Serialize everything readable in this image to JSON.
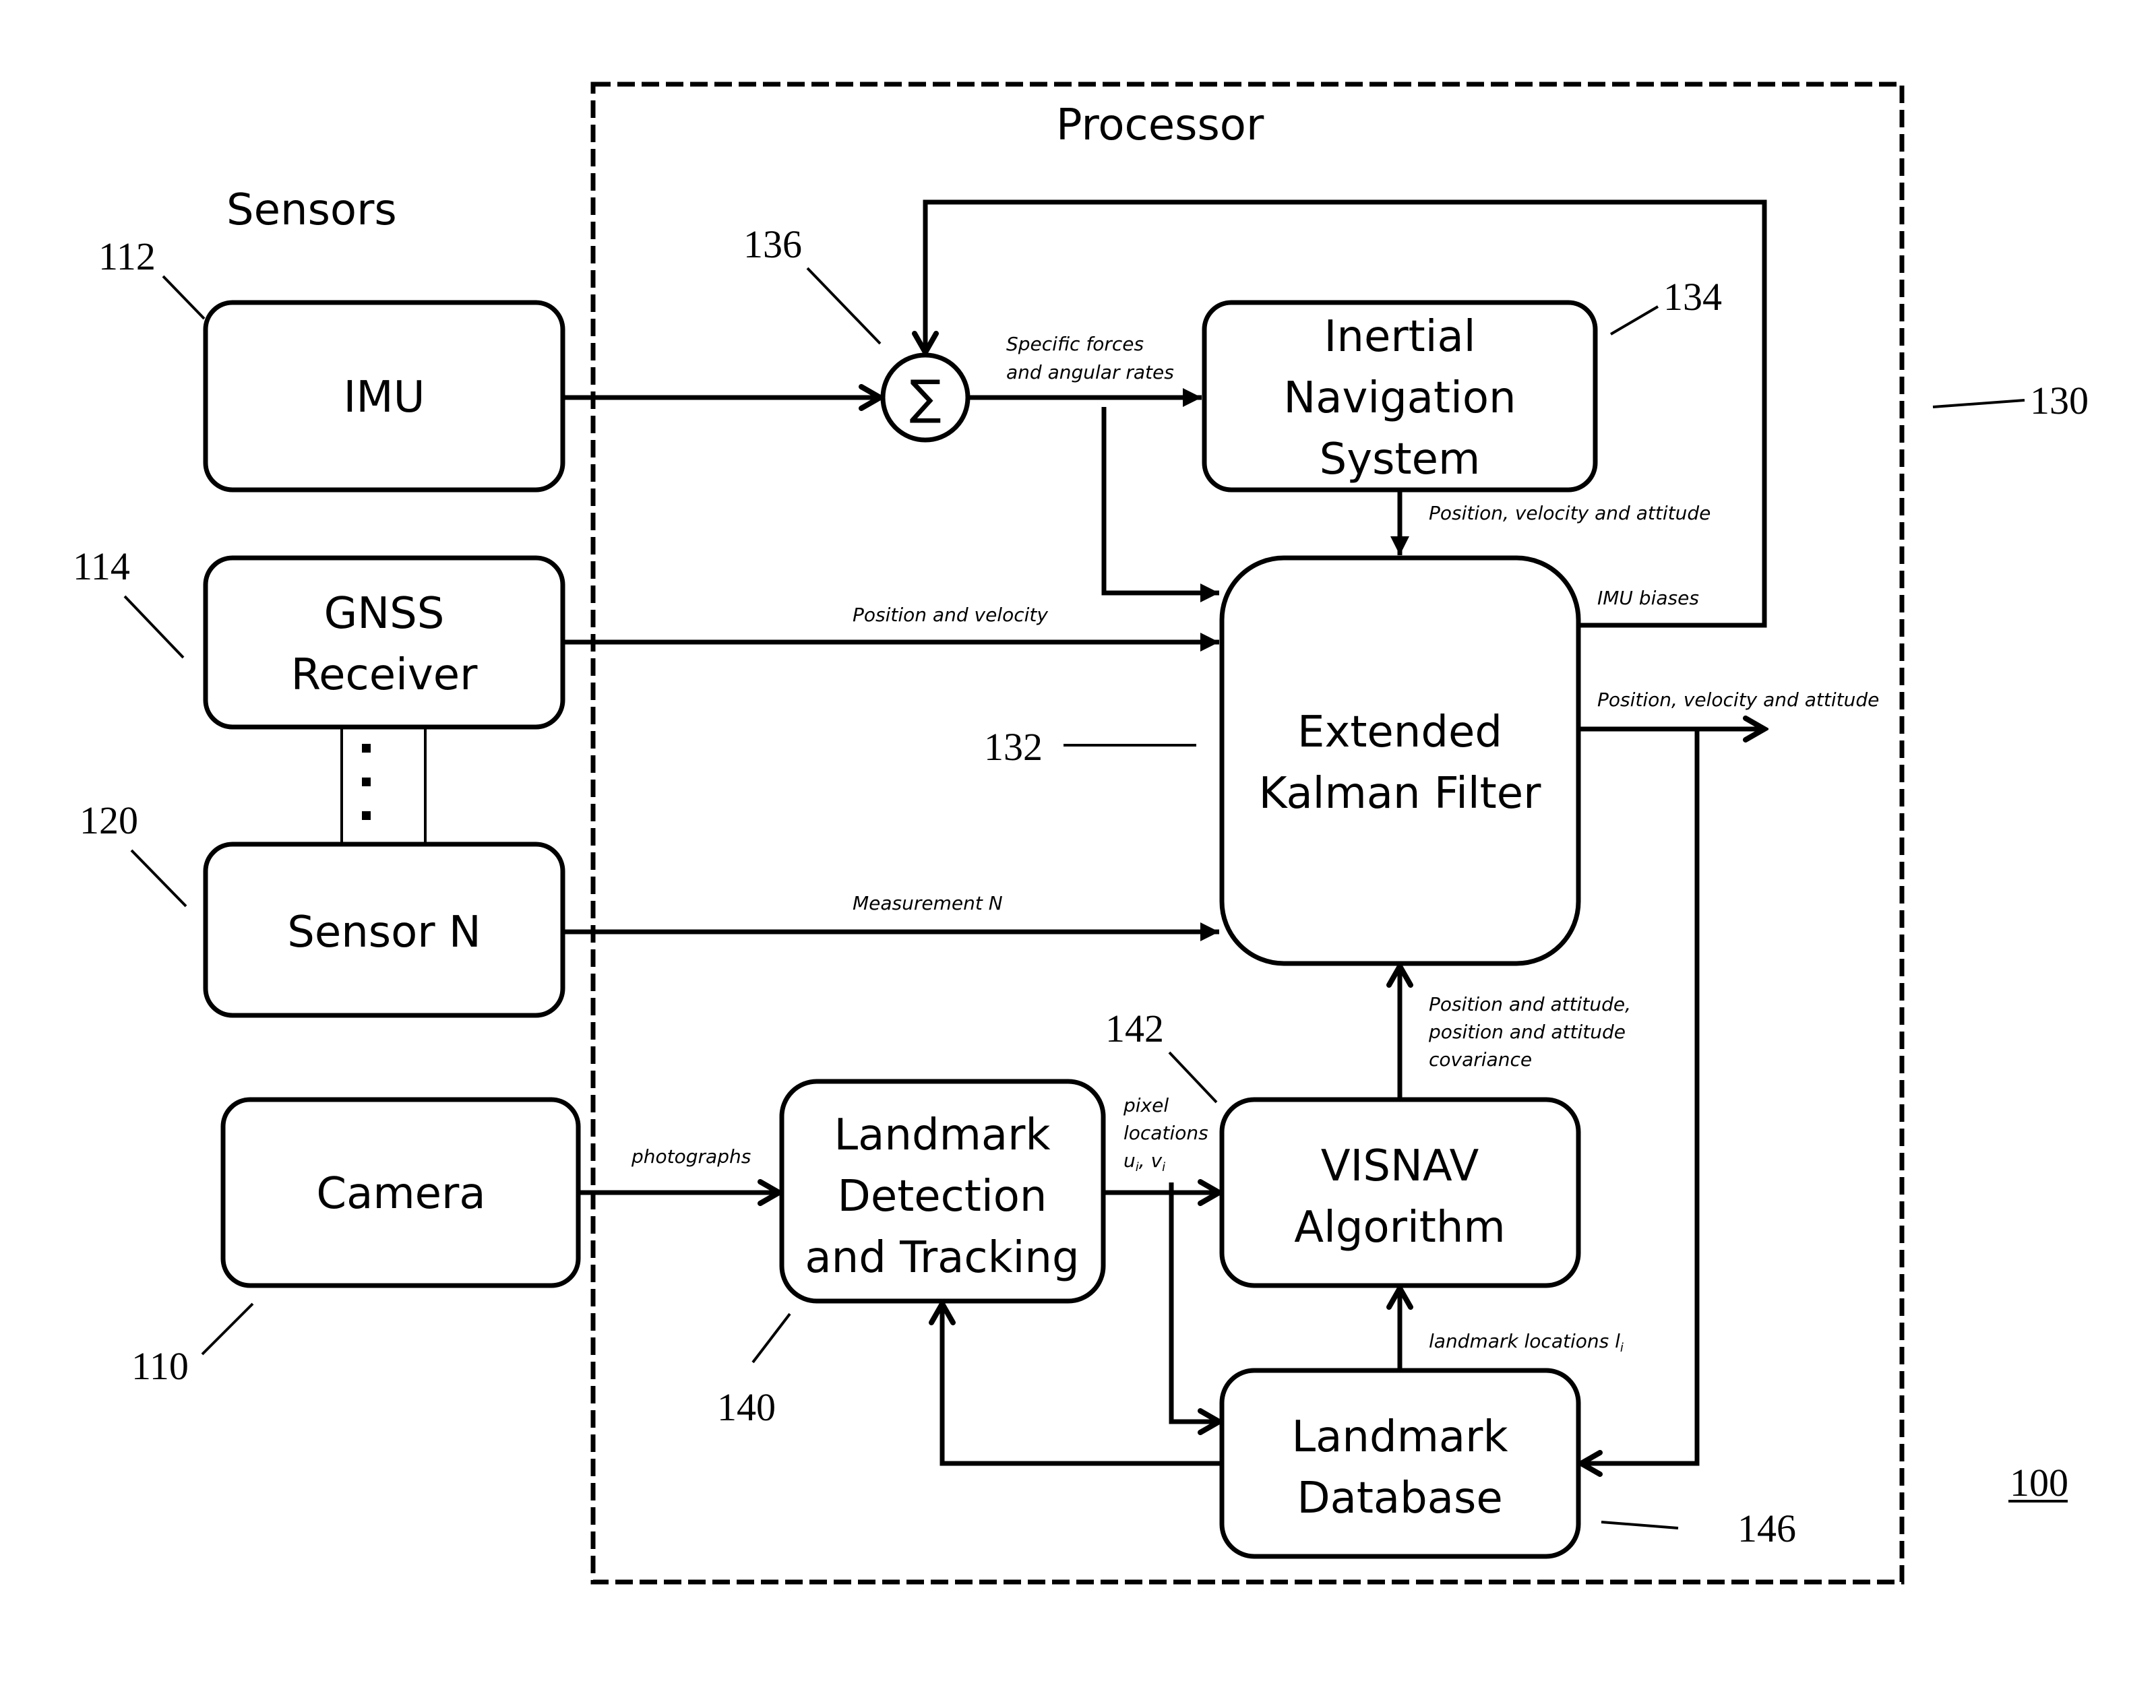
{
  "figure": {
    "ref_label": "100",
    "sections": {
      "sensors_title": "Sensors",
      "processor_title": "Processor"
    },
    "sensors": [
      {
        "id": "imu",
        "lines": [
          "IMU"
        ],
        "ref": "112"
      },
      {
        "id": "gnss",
        "lines": [
          "GNSS",
          "Receiver"
        ],
        "ref": "114"
      },
      {
        "id": "sensor_n",
        "lines": [
          "Sensor N"
        ],
        "ref": "120"
      },
      {
        "id": "camera",
        "lines": [
          "Camera"
        ],
        "ref": "110"
      }
    ],
    "processor": {
      "ref": "130",
      "summer": {
        "symbol": "∑",
        "ref": "136"
      },
      "ins": {
        "lines": [
          "Inertial",
          "Navigation",
          "System"
        ],
        "ref": "134"
      },
      "ekf": {
        "lines": [
          "Extended",
          "Kalman Filter"
        ],
        "ref": "132"
      },
      "ldt": {
        "lines": [
          "Landmark",
          "Detection",
          "and Tracking"
        ],
        "ref": "140"
      },
      "visnav": {
        "lines": [
          "VISNAV",
          "Algorithm"
        ],
        "ref": "142"
      },
      "database": {
        "lines": [
          "Landmark",
          "Database"
        ],
        "ref": "146"
      }
    },
    "edge_labels": {
      "specific_forces": [
        "Specific forces",
        "and angular rates"
      ],
      "ins_to_ekf": "Position, velocity and attitude",
      "imu_biases": "IMU biases",
      "gnss_to_ekf": "Position and velocity",
      "ekf_output": "Position, velocity and attitude",
      "sensor_n_to_ekf": "Measurement N",
      "visnav_to_ekf": [
        "Position and attitude,",
        "position and attitude",
        "covariance"
      ],
      "camera_to_ldt": "photographs",
      "pixel_locations": [
        "pixel",
        "locations"
      ],
      "pixel_vars": {
        "u": "u",
        "u_sub": "i",
        "sep": ", ",
        "v": "v",
        "v_sub": "i"
      },
      "landmark_locations": {
        "text": "landmark  locations l",
        "sub": "i"
      }
    }
  }
}
